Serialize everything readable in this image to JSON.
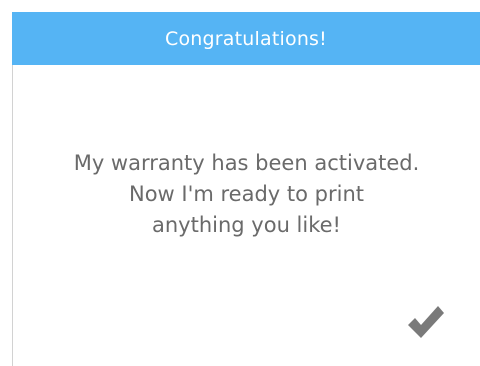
{
  "dialog": {
    "title": "Congratulations!",
    "message_lines": [
      "My warranty has been activated.",
      "Now I'm ready to print",
      "anything you like!"
    ],
    "confirm_icon": "checkmark-icon"
  },
  "colors": {
    "header": "#55b4f4",
    "header_text": "#ffffff",
    "message_text": "#6a6a6a",
    "checkmark": "#7a7a7a",
    "border": "#d2d2d2"
  }
}
